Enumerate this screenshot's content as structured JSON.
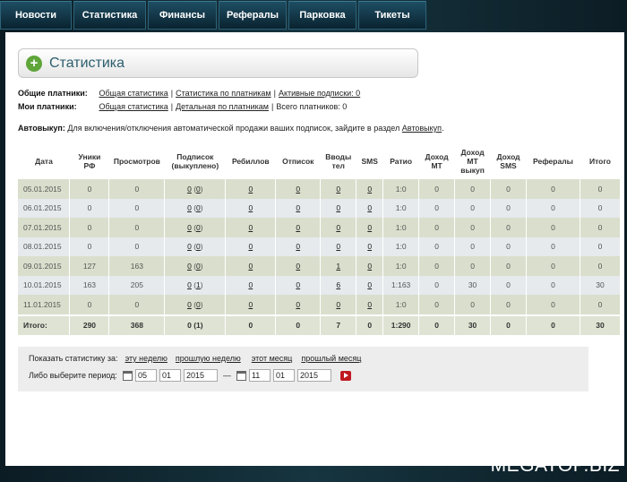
{
  "nav": [
    "Новости",
    "Статистика",
    "Финансы",
    "Рефералы",
    "Парковка",
    "Тикеты"
  ],
  "page_title": "Статистика",
  "common_payers": {
    "label": "Общие платники:",
    "links": [
      "Общая статистика",
      "Статистика по платникам",
      "Активные подписки: 0"
    ]
  },
  "my_payers": {
    "label": "Мои платники:",
    "links": [
      "Общая статистика",
      "Детальная по платникам"
    ],
    "total_text": "Всего платников: 0"
  },
  "autobuy": {
    "label": "Автовыкуп:",
    "text": "Для включения/отключения автоматической продажи ваших подписок, зайдите в раздел",
    "link": "Автовыкуп",
    "tail": "."
  },
  "table": {
    "headers": [
      "Дата",
      "Уники РФ",
      "Просмотров",
      "Подписок (выкуплено)",
      "Ребиллов",
      "Отписок",
      "Вводы тел",
      "SMS",
      "Ратио",
      "Доход МТ",
      "Доход МТ выкуп",
      "Доход SMS",
      "Рефералы",
      "Итого"
    ],
    "rows": [
      [
        "05.01.2015",
        "0",
        "0",
        "0",
        "0",
        "0",
        "0",
        "0",
        "0",
        "1:0",
        "0",
        "0",
        "0",
        "0",
        "0"
      ],
      [
        "06.01.2015",
        "0",
        "0",
        "0",
        "0",
        "0",
        "0",
        "0",
        "0",
        "1:0",
        "0",
        "0",
        "0",
        "0",
        "0"
      ],
      [
        "07.01.2015",
        "0",
        "0",
        "0",
        "0",
        "0",
        "0",
        "0",
        "0",
        "1:0",
        "0",
        "0",
        "0",
        "0",
        "0"
      ],
      [
        "08.01.2015",
        "0",
        "0",
        "0",
        "0",
        "0",
        "0",
        "0",
        "0",
        "1:0",
        "0",
        "0",
        "0",
        "0",
        "0"
      ],
      [
        "09.01.2015",
        "127",
        "163",
        "0",
        "0",
        "0",
        "0",
        "1",
        "0",
        "1:0",
        "0",
        "0",
        "0",
        "0",
        "0"
      ],
      [
        "10.01.2015",
        "163",
        "205",
        "0",
        "1",
        "0",
        "0",
        "6",
        "0",
        "1:163",
        "0",
        "30",
        "0",
        "0",
        "30"
      ],
      [
        "11.01.2015",
        "0",
        "0",
        "0",
        "0",
        "0",
        "0",
        "0",
        "0",
        "1:0",
        "0",
        "0",
        "0",
        "0",
        "0"
      ]
    ],
    "totals": [
      "Итого:",
      "290",
      "368",
      "0 (1)",
      "0",
      "0",
      "7",
      "0",
      "1:290",
      "0",
      "30",
      "0",
      "0",
      "30"
    ]
  },
  "filter": {
    "show_label": "Показать статистику за:",
    "periods": [
      "эту неделю",
      "прошлую неделю",
      "этот месяц",
      "прошлый месяц"
    ],
    "choose_label": "Либо выберите период:",
    "from": {
      "day": "05",
      "month": "01",
      "year": "2015"
    },
    "dash": "—",
    "to": {
      "day": "11",
      "month": "01",
      "year": "2015"
    }
  },
  "watermark": "MEGATOP.BIZ"
}
